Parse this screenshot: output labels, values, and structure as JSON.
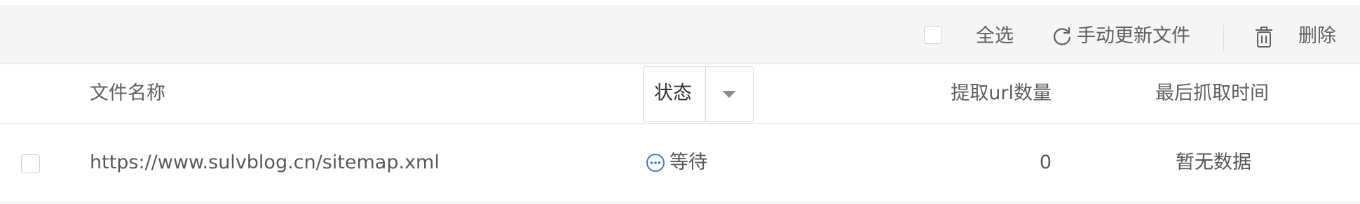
{
  "toolbar": {
    "select_all_label": "全选",
    "refresh_label": "手动更新文件",
    "delete_label": "删除"
  },
  "table": {
    "columns": {
      "name": "文件名称",
      "status": "状态",
      "url_count": "提取url数量",
      "last_crawl": "最后抓取时间"
    },
    "rows": [
      {
        "url": "https://www.sulvblog.cn/sitemap.xml",
        "status": "等待",
        "url_count": "0",
        "last_crawl": "暂无数据"
      }
    ]
  },
  "colors": {
    "toolbar_bg": "#f5f5f5",
    "status_icon": "#3b7ddd",
    "text": "#595959",
    "border": "#e6e6e6"
  },
  "icons": {
    "refresh": "refresh-icon",
    "delete": "trash-icon",
    "status_waiting": "more-circle-icon",
    "status_filter": "caret-down-icon"
  }
}
